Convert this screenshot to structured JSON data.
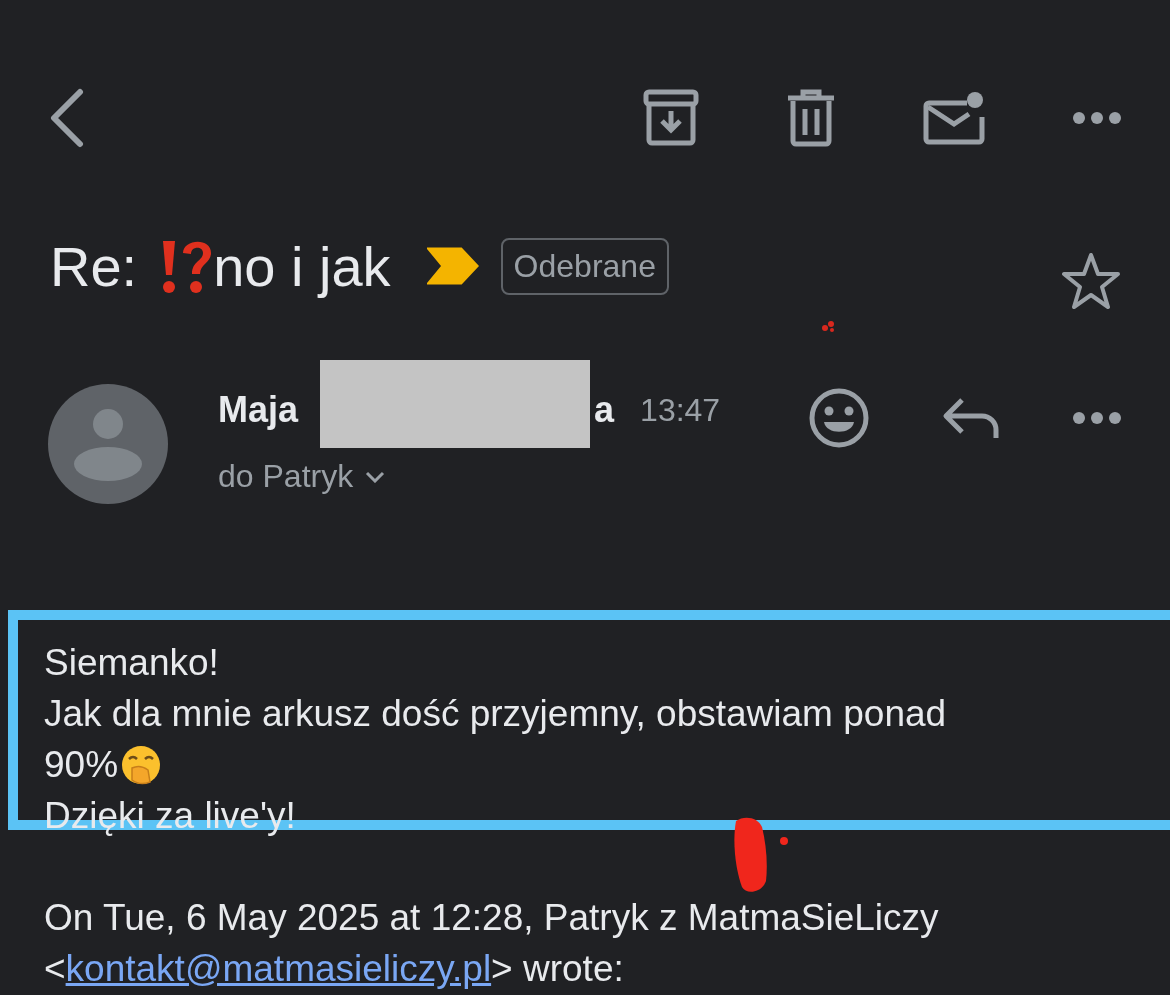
{
  "subject": {
    "prefix": "Re:",
    "text": "no i jak",
    "important": true,
    "label": "Odebrane",
    "starred": false
  },
  "message": {
    "sender_first": "Maja",
    "sender_last_visible": "a",
    "redacted": true,
    "time": "13:47",
    "recipient": "do Patryk",
    "body": [
      {
        "text": "Siemanko!",
        "emoji": false
      },
      {
        "text": "Jak dla mnie arkusz dość przyjemny, obstawiam ponad",
        "emoji": false
      },
      {
        "text": "90%",
        "emoji": true
      },
      {
        "text": "Dzięki za live'y!",
        "emoji": false
      }
    ],
    "quote": {
      "header": "On Tue, 6 May 2025 at 12:28, Patryk z MatmaSieLiczy",
      "open": "<",
      "email": "kontakt@matmasieliczy.pl",
      "close": "> wrote:"
    }
  }
}
